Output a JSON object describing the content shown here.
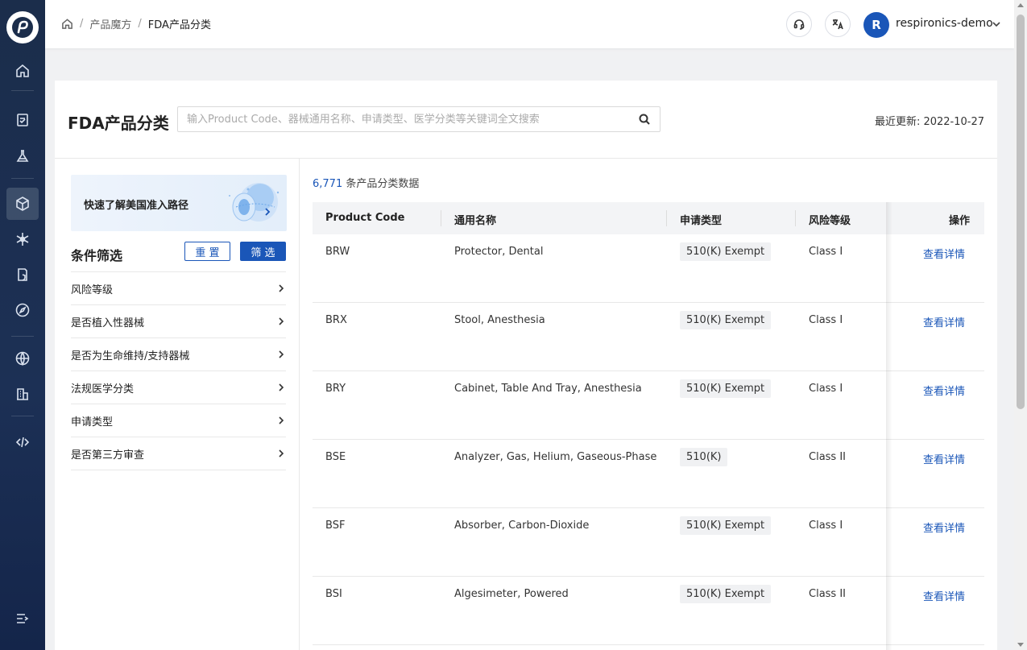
{
  "breadcrumb": {
    "level1": "产品魔方",
    "level2": "FDA产品分类"
  },
  "user": {
    "initial": "R",
    "name": "respironics-demo"
  },
  "page": {
    "title": "FDA产品分类",
    "search_placeholder": "输入Product Code、器械通用名称、申请类型、医学分类等关键词全文搜索",
    "last_update": "最近更新: 2022-10-27"
  },
  "promo": {
    "text": "快速了解美国准入路径"
  },
  "filters": {
    "title": "条件筛选",
    "reset_label": "重 置",
    "apply_label": "筛 选",
    "items": [
      {
        "label": "风险等级"
      },
      {
        "label": "是否植入性器械"
      },
      {
        "label": "是否为生命维持/支持器械"
      },
      {
        "label": "法规医学分类"
      },
      {
        "label": "申请类型"
      },
      {
        "label": "是否第三方审查"
      }
    ]
  },
  "results": {
    "count": "6,771",
    "suffix": " 条产品分类数据"
  },
  "table": {
    "headers": {
      "code": "Product Code",
      "name": "通用名称",
      "type": "申请类型",
      "risk": "风险等级",
      "action": "操作"
    },
    "rows": [
      {
        "code": "BRW",
        "name": "Protector, Dental",
        "type": "510(K) Exempt",
        "risk": "Class I",
        "action": "查看详情"
      },
      {
        "code": "BRX",
        "name": "Stool, Anesthesia",
        "type": "510(K) Exempt",
        "risk": "Class I",
        "action": "查看详情"
      },
      {
        "code": "BRY",
        "name": "Cabinet, Table And Tray, Anesthesia",
        "type": "510(K) Exempt",
        "risk": "Class I",
        "action": "查看详情"
      },
      {
        "code": "BSE",
        "name": "Analyzer, Gas, Helium, Gaseous-Phase",
        "type": "510(K)",
        "risk": "Class II",
        "action": "查看详情"
      },
      {
        "code": "BSF",
        "name": "Absorber, Carbon-Dioxide",
        "type": "510(K) Exempt",
        "risk": "Class I",
        "action": "查看详情"
      },
      {
        "code": "BSI",
        "name": "Algesimeter, Powered",
        "type": "510(K) Exempt",
        "risk": "Class II",
        "action": "查看详情"
      }
    ]
  },
  "colors": {
    "brand": "#1a56b8",
    "sidebar": "#1b2d4b"
  }
}
